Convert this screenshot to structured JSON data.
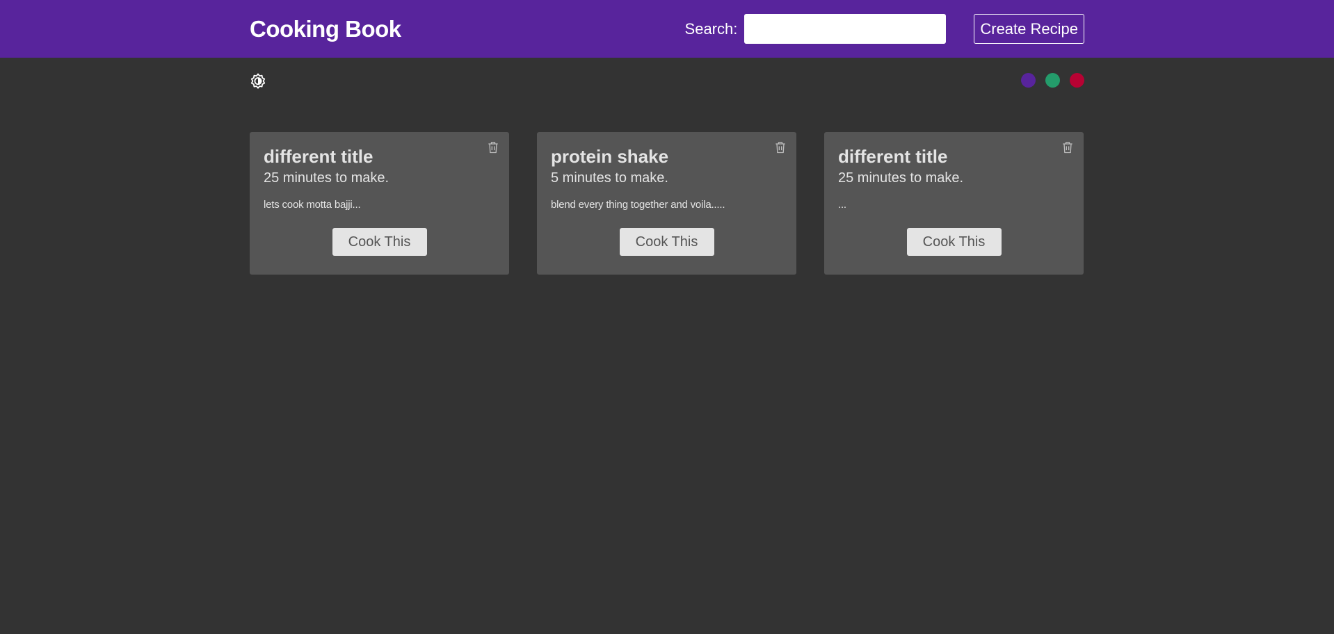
{
  "navbar": {
    "brand": "Cooking Book",
    "search_label": "Search:",
    "search_value": "",
    "create_label": "Create Recipe"
  },
  "theme": {
    "toggle_icon": "brightness-icon",
    "swatches": [
      {
        "name": "purple",
        "color": "#58249c"
      },
      {
        "name": "green",
        "color": "#249c6b"
      },
      {
        "name": "red",
        "color": "#b70233"
      }
    ]
  },
  "recipes": [
    {
      "title": "different title",
      "time": "25 minutes to make.",
      "snippet": "lets cook motta bajji...",
      "button": "Cook This"
    },
    {
      "title": "protein shake",
      "time": "5 minutes to make.",
      "snippet": "blend every thing together and voila.....",
      "button": "Cook This"
    },
    {
      "title": "different title",
      "time": "25 minutes to make.",
      "snippet": "...",
      "button": "Cook This"
    }
  ]
}
